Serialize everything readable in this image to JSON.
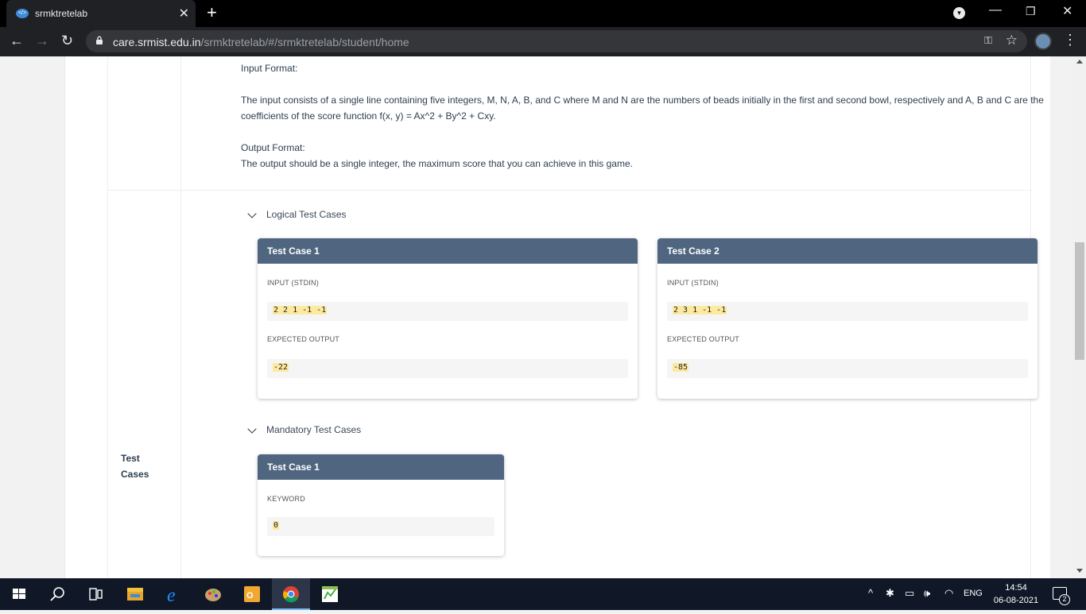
{
  "browser": {
    "tab_title": "srmktretelab",
    "favicon_text": "</>",
    "url_host": "care.srmist.edu.in",
    "url_path": "/srmktretelab/#/srmktretelab/student/home"
  },
  "problem": {
    "input_format_title": "Input Format:",
    "input_format_text_1": "The input consists of a single line containing five integers, M, N, A, B, and C where M and N are the numbers of beads initially in the first and second bowl, respectively and A, B and C are the",
    "input_format_text_2": "coefficients of the score function f(x, y) = Ax^2 + By^2 + Cxy.",
    "output_format_title": "Output Format:",
    "output_format_text": "The output should be a single integer, the maximum score that you can achieve in this game."
  },
  "test_cases": {
    "row_label": "Test Cases",
    "logical_title": "Logical Test Cases",
    "logical": [
      {
        "title": "Test Case 1",
        "input_label": "INPUT (STDIN)",
        "input": "2 2 1 -1 -1",
        "output_label": "EXPECTED OUTPUT",
        "output": "-22"
      },
      {
        "title": "Test Case 2",
        "input_label": "INPUT (STDIN)",
        "input": "2 3 1 -1 -1",
        "output_label": "EXPECTED OUTPUT",
        "output": "-85"
      }
    ],
    "mandatory_title": "Mandatory Test Cases",
    "mandatory": [
      {
        "title": "Test Case 1",
        "keyword_label": "KEYWORD",
        "keyword": "0"
      }
    ]
  },
  "taskbar": {
    "time": "14:54",
    "date": "06-08-2021",
    "language": "ENG",
    "notification_count": "2"
  }
}
